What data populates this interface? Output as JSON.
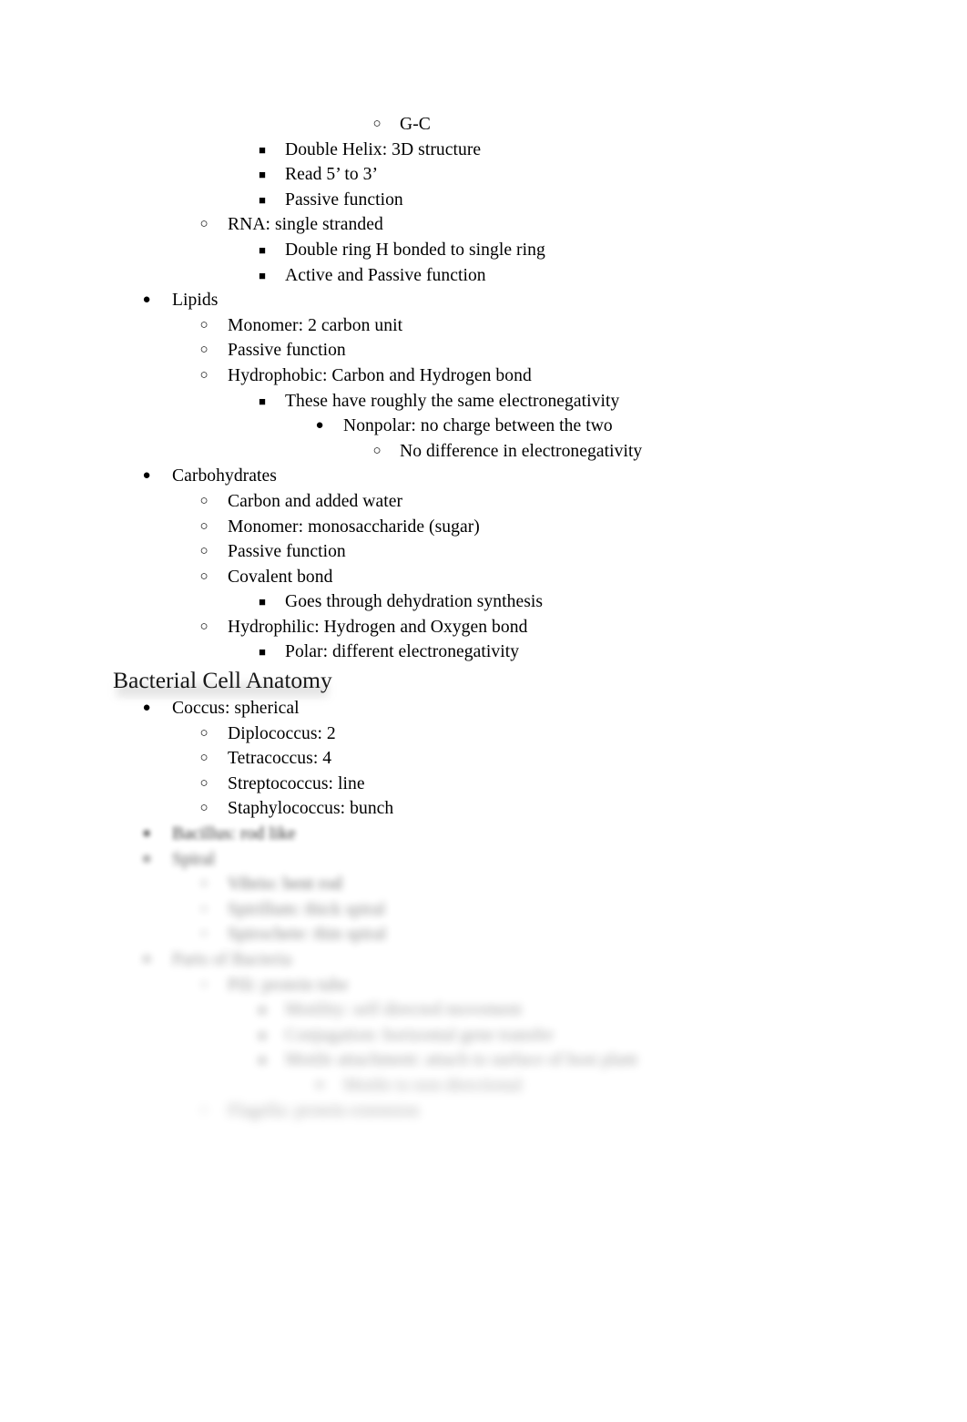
{
  "document": {
    "background_color": "#ffffff",
    "text_color": "#000000",
    "heading_color": "#181818"
  },
  "outline": [
    {
      "level": 5,
      "marker": "circle",
      "text": "G-C",
      "blur": 0
    },
    {
      "level": 3,
      "marker": "square",
      "text": "Double Helix: 3D structure",
      "blur": 0
    },
    {
      "level": 3,
      "marker": "square",
      "text": "Read 5’ to 3’",
      "blur": 0
    },
    {
      "level": 3,
      "marker": "square",
      "text": "Passive function",
      "blur": 0
    },
    {
      "level": 2,
      "marker": "circle",
      "text": "RNA: single stranded",
      "blur": 0
    },
    {
      "level": 3,
      "marker": "square",
      "text": "Double ring H bonded to single ring",
      "blur": 0
    },
    {
      "level": 3,
      "marker": "square",
      "text": "Active and Passive function",
      "blur": 0
    },
    {
      "level": 1,
      "marker": "disc",
      "text": "Lipids",
      "blur": 0
    },
    {
      "level": 2,
      "marker": "circle",
      "text": "Monomer: 2 carbon unit",
      "blur": 0
    },
    {
      "level": 2,
      "marker": "circle",
      "text": "Passive function",
      "blur": 0
    },
    {
      "level": 2,
      "marker": "circle",
      "text": "Hydrophobic: Carbon and Hydrogen bond",
      "blur": 0
    },
    {
      "level": 3,
      "marker": "square",
      "text": "These have roughly the same electronegativity",
      "blur": 0
    },
    {
      "level": 4,
      "marker": "disc",
      "text": "Nonpolar: no charge between the two",
      "blur": 0
    },
    {
      "level": 5,
      "marker": "circle",
      "text": "No difference in electronegativity",
      "blur": 0
    },
    {
      "level": 1,
      "marker": "disc",
      "text": "Carbohydrates",
      "blur": 0
    },
    {
      "level": 2,
      "marker": "circle",
      "text": "Carbon and added water",
      "blur": 0
    },
    {
      "level": 2,
      "marker": "circle",
      "text": "Monomer: monosaccharide (sugar)",
      "blur": 0
    },
    {
      "level": 2,
      "marker": "circle",
      "text": "Passive function",
      "blur": 0
    },
    {
      "level": 2,
      "marker": "circle",
      "text": "Covalent bond",
      "blur": 0
    },
    {
      "level": 3,
      "marker": "square",
      "text": "Goes through dehydration synthesis",
      "blur": 0
    },
    {
      "level": 2,
      "marker": "circle",
      "text": "Hydrophilic: Hydrogen and Oxygen bond",
      "blur": 0
    },
    {
      "level": 3,
      "marker": "square",
      "text": "Polar: different electronegativity",
      "blur": 0
    }
  ],
  "section_heading": {
    "text": "Bacterial Cell Anatomy"
  },
  "outline_after_heading": [
    {
      "level": 1,
      "marker": "disc",
      "text": "Coccus: spherical",
      "blur": 0
    },
    {
      "level": 2,
      "marker": "circle",
      "text": "Diplococcus: 2",
      "blur": 0
    },
    {
      "level": 2,
      "marker": "circle",
      "text": "Tetracoccus: 4",
      "blur": 0
    },
    {
      "level": 2,
      "marker": "circle",
      "text": "Streptococcus: line",
      "blur": 0
    },
    {
      "level": 2,
      "marker": "circle",
      "text": "Staphylococcus: bunch",
      "blur": 0
    },
    {
      "level": 1,
      "marker": "disc",
      "text": "Bacillus: rod like",
      "blur": 1,
      "crisp_bullet": true
    },
    {
      "level": 1,
      "marker": "disc",
      "text": "Spiral",
      "blur": 2
    },
    {
      "level": 2,
      "marker": "circle",
      "text": "Vibrio: bent rod",
      "blur": 3
    },
    {
      "level": 2,
      "marker": "circle",
      "text": "Spirillum: thick spiral",
      "blur": 4
    },
    {
      "level": 2,
      "marker": "circle",
      "text": "Spirochete: thin spiral",
      "blur": 4
    },
    {
      "level": 1,
      "marker": "disc",
      "text": "Parts of Bacteria",
      "blur": 5
    },
    {
      "level": 2,
      "marker": "circle",
      "text": "Pili: protein tube",
      "blur": 5
    },
    {
      "level": 3,
      "marker": "square",
      "text": "Motility: self directed movement",
      "blur": 6
    },
    {
      "level": 3,
      "marker": "square",
      "text": "Conjugation: horizontal gene transfer",
      "blur": 6
    },
    {
      "level": 3,
      "marker": "square",
      "text": "Motile attachment: attach to surface of host plant",
      "blur": 6
    },
    {
      "level": 4,
      "marker": "disc",
      "text": "Motile to non directional",
      "blur": 7
    },
    {
      "level": 2,
      "marker": "circle",
      "text": "Flagella: protein extension",
      "blur": 7
    }
  ]
}
